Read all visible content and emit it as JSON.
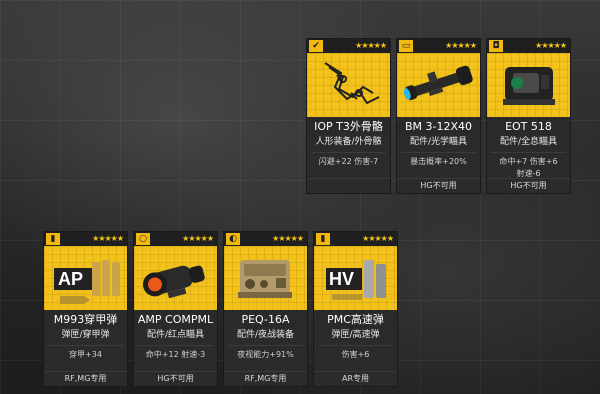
{
  "cards": [
    {
      "id": "iop",
      "icon": "exoskeleton-icon",
      "stars": "★★★★★",
      "name": "IOP T3外骨骼",
      "sub": "人形装备/外骨骼",
      "stat1": "闪避+22 伤害-7",
      "stat2": "",
      "restrict": ""
    },
    {
      "id": "bm",
      "icon": "scope-icon",
      "stars": "★★★★★",
      "name": "BM 3-12X40",
      "sub": "配件/光学瞄具",
      "stat1": "暴击概率+20%",
      "stat2": "",
      "restrict": "HG不可用"
    },
    {
      "id": "eot",
      "icon": "holo-sight-icon",
      "stars": "★★★★★",
      "name": "EOT 518",
      "sub": "配件/全息瞄具",
      "stat1": "命中+7 伤害+6",
      "stat2": "射速-6",
      "restrict": "HG不可用"
    },
    {
      "id": "m993",
      "icon": "ammo-icon",
      "stars": "★★★★★",
      "name": "M993穿甲弹",
      "sub": "弹匣/穿甲弹",
      "stat1": "穿甲+34",
      "stat2": "",
      "restrict": "RF,MG专用",
      "art_label": "AP"
    },
    {
      "id": "amp",
      "icon": "red-dot-icon",
      "stars": "★★★★★",
      "name": "AMP COMPML",
      "sub": "配件/红点瞄具",
      "stat1": "命中+12 射速-3",
      "stat2": "",
      "restrict": "HG不可用"
    },
    {
      "id": "peq",
      "icon": "night-vision-icon",
      "stars": "★★★★★",
      "name": "PEQ-16A",
      "sub": "配件/夜战装备",
      "stat1": "夜视能力+91%",
      "stat2": "",
      "restrict": "RF,MG专用"
    },
    {
      "id": "pmc",
      "icon": "hv-ammo-icon",
      "stars": "★★★★★",
      "name": "PMC高速弹",
      "sub": "弹匣/高速弹",
      "stat1": "伤害+6",
      "stat2": "",
      "restrict": "AR专用",
      "art_label": "HV"
    }
  ]
}
